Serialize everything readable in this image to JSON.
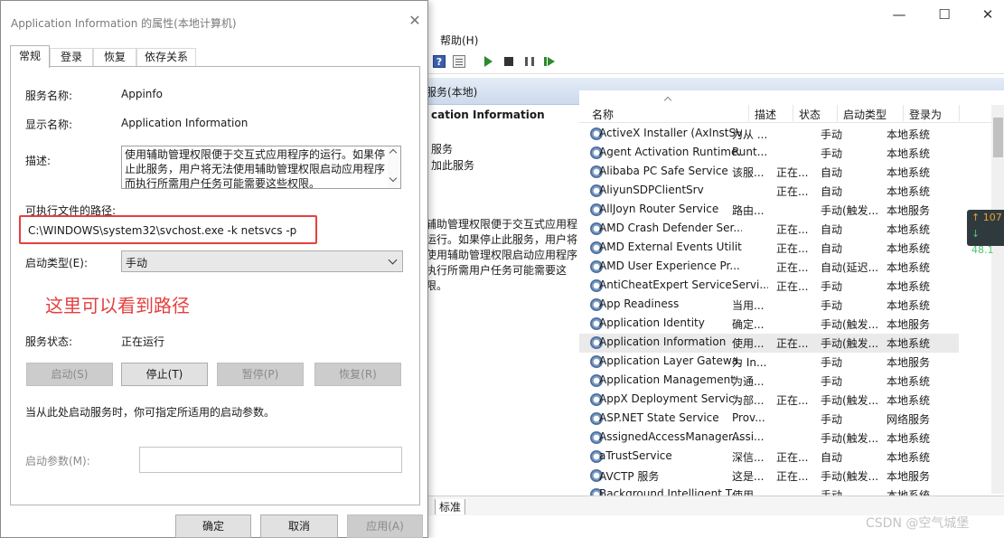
{
  "services_window": {
    "menu_help": "帮助(H)",
    "toolbar_help_glyph": "?",
    "header_title": "服务(本地)",
    "desc_title": "cation Information",
    "desc_link1": "服务",
    "desc_link2": "加此服务",
    "desc_text": "辅助管理权限便于交互式应用程运行。如果停止此服务，用户将使用辅助管理权限启动应用程序执行所需用户任务可能需要这限。",
    "columns": {
      "name": "名称",
      "desc": "描述",
      "status": "状态",
      "startup": "启动类型",
      "logon": "登录为"
    },
    "rows": [
      {
        "name": "ActiveX Installer (AxInstSV)",
        "desc": "为从 ...",
        "status": "",
        "startup": "手动",
        "logon": "本地系统"
      },
      {
        "name": "Agent Activation Runtime...",
        "desc": "Runt...",
        "status": "",
        "startup": "手动",
        "logon": "本地系统"
      },
      {
        "name": "Alibaba PC Safe Service",
        "desc": "该服...",
        "status": "正在...",
        "startup": "自动",
        "logon": "本地系统"
      },
      {
        "name": "AliyunSDPClientSrv",
        "desc": "",
        "status": "正在...",
        "startup": "自动",
        "logon": "本地系统"
      },
      {
        "name": "AllJoyn Router Service",
        "desc": "路由...",
        "status": "",
        "startup": "手动(触发...",
        "logon": "本地服务"
      },
      {
        "name": "AMD Crash Defender Ser...",
        "desc": "",
        "status": "正在...",
        "startup": "自动",
        "logon": "本地系统"
      },
      {
        "name": "AMD External Events Utility",
        "desc": "",
        "status": "正在...",
        "startup": "自动",
        "logon": "本地系统"
      },
      {
        "name": "AMD User Experience Pr...",
        "desc": "",
        "status": "正在...",
        "startup": "自动(延迟...",
        "logon": "本地系统"
      },
      {
        "name": "AntiCheatExpert Service",
        "desc": "Servi...",
        "status": "正在...",
        "startup": "手动",
        "logon": "本地系统"
      },
      {
        "name": "App Readiness",
        "desc": "当用...",
        "status": "",
        "startup": "手动",
        "logon": "本地系统"
      },
      {
        "name": "Application Identity",
        "desc": "确定...",
        "status": "",
        "startup": "手动(触发...",
        "logon": "本地服务"
      },
      {
        "name": "Application Information",
        "desc": "使用...",
        "status": "正在...",
        "startup": "手动(触发...",
        "logon": "本地系统",
        "selected": true
      },
      {
        "name": "Application Layer Gatewa...",
        "desc": "为 In...",
        "status": "",
        "startup": "手动",
        "logon": "本地服务"
      },
      {
        "name": "Application Management",
        "desc": "为通...",
        "status": "",
        "startup": "手动",
        "logon": "本地系统"
      },
      {
        "name": "AppX Deployment Servic...",
        "desc": "为部...",
        "status": "正在...",
        "startup": "手动(触发...",
        "logon": "本地系统"
      },
      {
        "name": "ASP.NET State Service",
        "desc": "Prov...",
        "status": "",
        "startup": "手动",
        "logon": "网络服务"
      },
      {
        "name": "AssignedAccessManager...",
        "desc": "Assi...",
        "status": "",
        "startup": "手动(触发...",
        "logon": "本地系统"
      },
      {
        "name": "aTrustService",
        "desc": "深信...",
        "status": "正在...",
        "startup": "自动",
        "logon": "本地系统"
      },
      {
        "name": "AVCTP 服务",
        "desc": "这是...",
        "status": "正在...",
        "startup": "手动(触发...",
        "logon": "本地服务"
      },
      {
        "name": "Background Intelligent T...",
        "desc": "使用...",
        "status": "",
        "startup": "手动",
        "logon": "本地系统"
      }
    ],
    "bottom_tab": "标准",
    "badge_up": "↑ 107",
    "badge_down": "↓ 48.1",
    "watermark": "CSDN @空气城堡"
  },
  "dialog": {
    "title": "Application Information 的属性(本地计算机)",
    "tabs": [
      "常规",
      "登录",
      "恢复",
      "依存关系"
    ],
    "service_name_label": "服务名称:",
    "service_name_value": "Appinfo",
    "display_name_label": "显示名称:",
    "display_name_value": "Application Information",
    "description_label": "描述:",
    "description_value": "使用辅助管理权限便于交互式应用程序的运行。如果停止此服务，用户将无法使用辅助管理权限启动应用程序而执行所需用户任务可能需要这些权限。",
    "exe_path_label": "可执行文件的路径:",
    "exe_path_value": "C:\\WINDOWS\\system32\\svchost.exe -k netsvcs -p",
    "startup_type_label": "启动类型(E):",
    "startup_type_value": "手动",
    "annotation": "这里可以看到路径",
    "service_status_label": "服务状态:",
    "service_status_value": "正在运行",
    "btn_start": "启动(S)",
    "btn_stop": "停止(T)",
    "btn_pause": "暂停(P)",
    "btn_resume": "恢复(R)",
    "hint": "当从此处启动服务时，你可指定所适用的启动参数。",
    "start_params_label": "启动参数(M):",
    "btn_ok": "确定",
    "btn_cancel": "取消",
    "btn_apply": "应用(A)"
  },
  "colors": {
    "annotation_red": "#e54040",
    "selected_row": "#eaeaea",
    "header_blue": "#cddaec"
  }
}
